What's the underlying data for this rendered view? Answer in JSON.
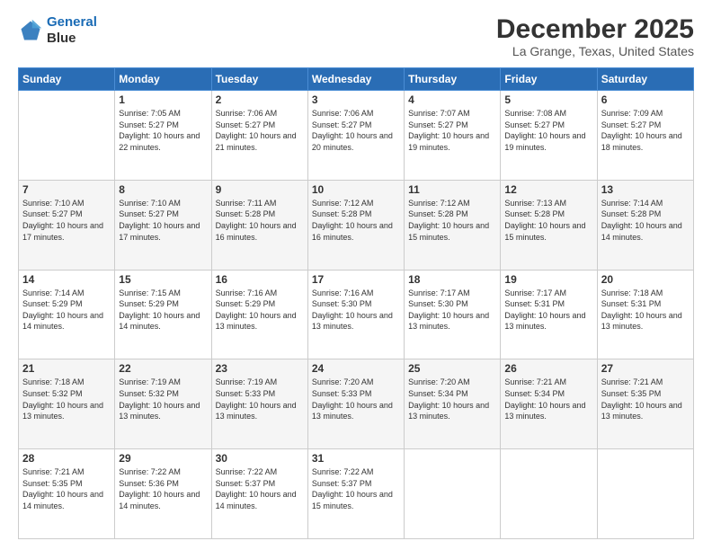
{
  "header": {
    "logo_line1": "General",
    "logo_line2": "Blue",
    "month": "December 2025",
    "location": "La Grange, Texas, United States"
  },
  "days_of_week": [
    "Sunday",
    "Monday",
    "Tuesday",
    "Wednesday",
    "Thursday",
    "Friday",
    "Saturday"
  ],
  "weeks": [
    [
      {
        "day": "",
        "sunrise": "",
        "sunset": "",
        "daylight": ""
      },
      {
        "day": "1",
        "sunrise": "Sunrise: 7:05 AM",
        "sunset": "Sunset: 5:27 PM",
        "daylight": "Daylight: 10 hours and 22 minutes."
      },
      {
        "day": "2",
        "sunrise": "Sunrise: 7:06 AM",
        "sunset": "Sunset: 5:27 PM",
        "daylight": "Daylight: 10 hours and 21 minutes."
      },
      {
        "day": "3",
        "sunrise": "Sunrise: 7:06 AM",
        "sunset": "Sunset: 5:27 PM",
        "daylight": "Daylight: 10 hours and 20 minutes."
      },
      {
        "day": "4",
        "sunrise": "Sunrise: 7:07 AM",
        "sunset": "Sunset: 5:27 PM",
        "daylight": "Daylight: 10 hours and 19 minutes."
      },
      {
        "day": "5",
        "sunrise": "Sunrise: 7:08 AM",
        "sunset": "Sunset: 5:27 PM",
        "daylight": "Daylight: 10 hours and 19 minutes."
      },
      {
        "day": "6",
        "sunrise": "Sunrise: 7:09 AM",
        "sunset": "Sunset: 5:27 PM",
        "daylight": "Daylight: 10 hours and 18 minutes."
      }
    ],
    [
      {
        "day": "7",
        "sunrise": "Sunrise: 7:10 AM",
        "sunset": "Sunset: 5:27 PM",
        "daylight": "Daylight: 10 hours and 17 minutes."
      },
      {
        "day": "8",
        "sunrise": "Sunrise: 7:10 AM",
        "sunset": "Sunset: 5:27 PM",
        "daylight": "Daylight: 10 hours and 17 minutes."
      },
      {
        "day": "9",
        "sunrise": "Sunrise: 7:11 AM",
        "sunset": "Sunset: 5:28 PM",
        "daylight": "Daylight: 10 hours and 16 minutes."
      },
      {
        "day": "10",
        "sunrise": "Sunrise: 7:12 AM",
        "sunset": "Sunset: 5:28 PM",
        "daylight": "Daylight: 10 hours and 16 minutes."
      },
      {
        "day": "11",
        "sunrise": "Sunrise: 7:12 AM",
        "sunset": "Sunset: 5:28 PM",
        "daylight": "Daylight: 10 hours and 15 minutes."
      },
      {
        "day": "12",
        "sunrise": "Sunrise: 7:13 AM",
        "sunset": "Sunset: 5:28 PM",
        "daylight": "Daylight: 10 hours and 15 minutes."
      },
      {
        "day": "13",
        "sunrise": "Sunrise: 7:14 AM",
        "sunset": "Sunset: 5:28 PM",
        "daylight": "Daylight: 10 hours and 14 minutes."
      }
    ],
    [
      {
        "day": "14",
        "sunrise": "Sunrise: 7:14 AM",
        "sunset": "Sunset: 5:29 PM",
        "daylight": "Daylight: 10 hours and 14 minutes."
      },
      {
        "day": "15",
        "sunrise": "Sunrise: 7:15 AM",
        "sunset": "Sunset: 5:29 PM",
        "daylight": "Daylight: 10 hours and 14 minutes."
      },
      {
        "day": "16",
        "sunrise": "Sunrise: 7:16 AM",
        "sunset": "Sunset: 5:29 PM",
        "daylight": "Daylight: 10 hours and 13 minutes."
      },
      {
        "day": "17",
        "sunrise": "Sunrise: 7:16 AM",
        "sunset": "Sunset: 5:30 PM",
        "daylight": "Daylight: 10 hours and 13 minutes."
      },
      {
        "day": "18",
        "sunrise": "Sunrise: 7:17 AM",
        "sunset": "Sunset: 5:30 PM",
        "daylight": "Daylight: 10 hours and 13 minutes."
      },
      {
        "day": "19",
        "sunrise": "Sunrise: 7:17 AM",
        "sunset": "Sunset: 5:31 PM",
        "daylight": "Daylight: 10 hours and 13 minutes."
      },
      {
        "day": "20",
        "sunrise": "Sunrise: 7:18 AM",
        "sunset": "Sunset: 5:31 PM",
        "daylight": "Daylight: 10 hours and 13 minutes."
      }
    ],
    [
      {
        "day": "21",
        "sunrise": "Sunrise: 7:18 AM",
        "sunset": "Sunset: 5:32 PM",
        "daylight": "Daylight: 10 hours and 13 minutes."
      },
      {
        "day": "22",
        "sunrise": "Sunrise: 7:19 AM",
        "sunset": "Sunset: 5:32 PM",
        "daylight": "Daylight: 10 hours and 13 minutes."
      },
      {
        "day": "23",
        "sunrise": "Sunrise: 7:19 AM",
        "sunset": "Sunset: 5:33 PM",
        "daylight": "Daylight: 10 hours and 13 minutes."
      },
      {
        "day": "24",
        "sunrise": "Sunrise: 7:20 AM",
        "sunset": "Sunset: 5:33 PM",
        "daylight": "Daylight: 10 hours and 13 minutes."
      },
      {
        "day": "25",
        "sunrise": "Sunrise: 7:20 AM",
        "sunset": "Sunset: 5:34 PM",
        "daylight": "Daylight: 10 hours and 13 minutes."
      },
      {
        "day": "26",
        "sunrise": "Sunrise: 7:21 AM",
        "sunset": "Sunset: 5:34 PM",
        "daylight": "Daylight: 10 hours and 13 minutes."
      },
      {
        "day": "27",
        "sunrise": "Sunrise: 7:21 AM",
        "sunset": "Sunset: 5:35 PM",
        "daylight": "Daylight: 10 hours and 13 minutes."
      }
    ],
    [
      {
        "day": "28",
        "sunrise": "Sunrise: 7:21 AM",
        "sunset": "Sunset: 5:35 PM",
        "daylight": "Daylight: 10 hours and 14 minutes."
      },
      {
        "day": "29",
        "sunrise": "Sunrise: 7:22 AM",
        "sunset": "Sunset: 5:36 PM",
        "daylight": "Daylight: 10 hours and 14 minutes."
      },
      {
        "day": "30",
        "sunrise": "Sunrise: 7:22 AM",
        "sunset": "Sunset: 5:37 PM",
        "daylight": "Daylight: 10 hours and 14 minutes."
      },
      {
        "day": "31",
        "sunrise": "Sunrise: 7:22 AM",
        "sunset": "Sunset: 5:37 PM",
        "daylight": "Daylight: 10 hours and 15 minutes."
      },
      {
        "day": "",
        "sunrise": "",
        "sunset": "",
        "daylight": ""
      },
      {
        "day": "",
        "sunrise": "",
        "sunset": "",
        "daylight": ""
      },
      {
        "day": "",
        "sunrise": "",
        "sunset": "",
        "daylight": ""
      }
    ]
  ]
}
